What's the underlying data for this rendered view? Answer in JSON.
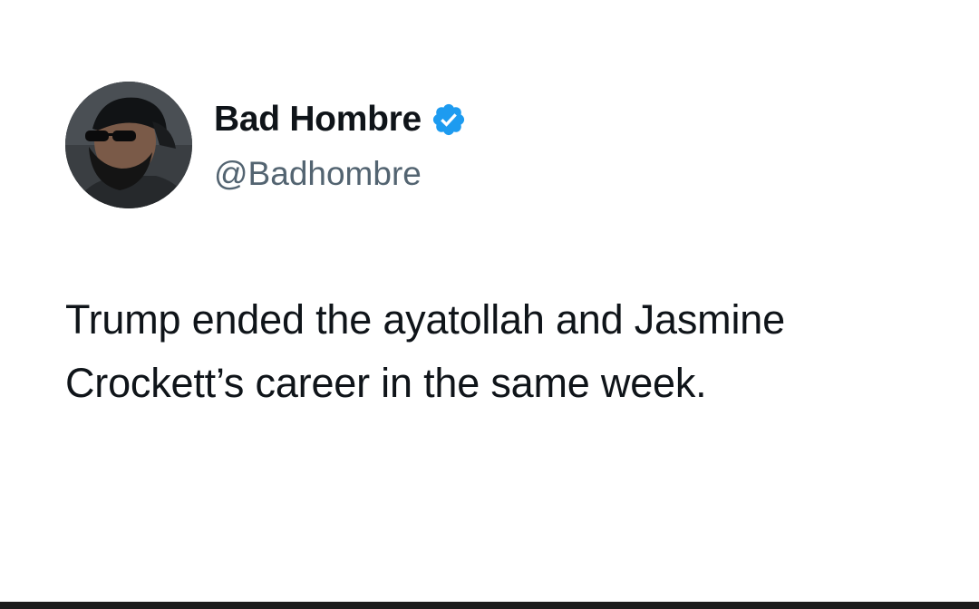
{
  "author": {
    "display_name": "Bad Hombre",
    "handle": "@Badhombre",
    "verified": true,
    "verified_icon": "verified-badge-icon",
    "avatar": "profile-photo"
  },
  "tweet": {
    "lines": [
      "Trump ended the ayatollah and Jasmine",
      "Crockett’s career in the same week."
    ]
  },
  "colors": {
    "text": "#0f1419",
    "secondary_text": "#536471",
    "verified": "#1d9bf0",
    "background": "#ffffff"
  }
}
